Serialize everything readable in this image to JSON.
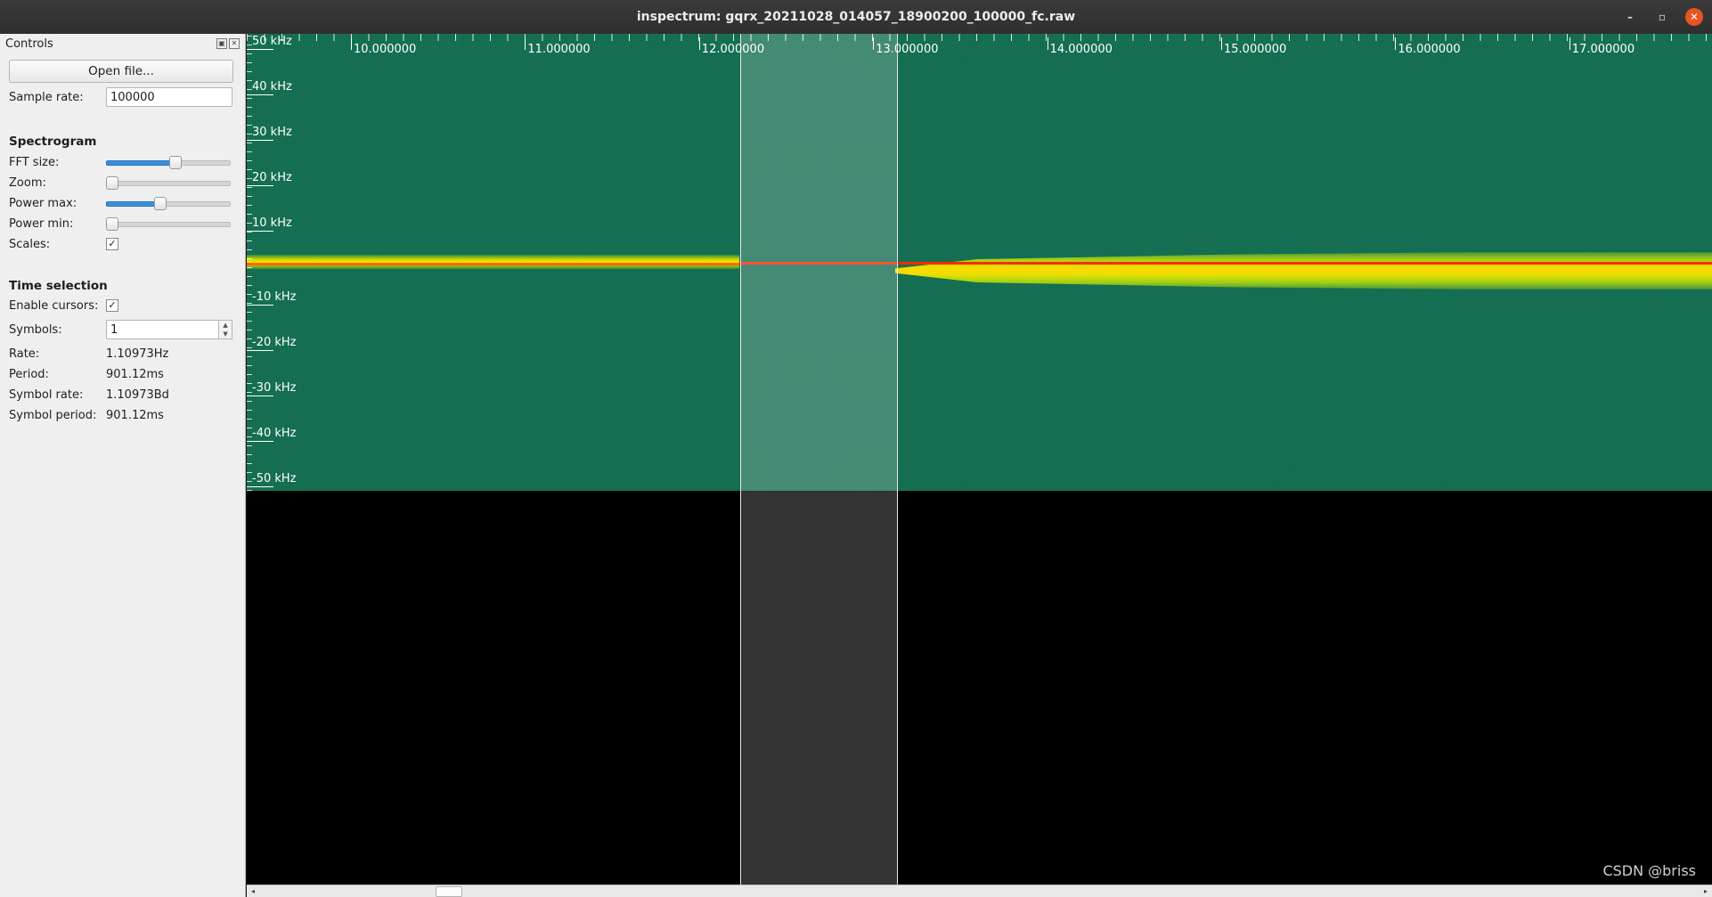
{
  "window": {
    "title": "inspectrum: gqrx_20211028_014057_18900200_100000_fc.raw",
    "minimize": "–",
    "restore": "▫",
    "close": "✕"
  },
  "controls": {
    "dock_title": "Controls",
    "float_icon": "▣",
    "close_icon": "✕",
    "open_file_label": "Open file...",
    "sample_rate_label": "Sample rate:",
    "sample_rate_value": "100000",
    "spectrogram_heading": "Spectrogram",
    "fft_size_label": "FFT size:",
    "fft_size_level": 0.55,
    "zoom_label": "Zoom:",
    "zoom_level": 0.0,
    "power_max_label": "Power max:",
    "power_max_level": 0.43,
    "power_min_label": "Power min:",
    "power_min_level": 0.0,
    "scales_label": "Scales:",
    "scales_checked": "✓",
    "time_selection_heading": "Time selection",
    "enable_cursors_label": "Enable cursors:",
    "enable_cursors_checked": "✓",
    "symbols_label": "Symbols:",
    "symbols_value": "1",
    "rate_label": "Rate:",
    "rate_value": "1.10973Hz",
    "period_label": "Period:",
    "period_value": "901.12ms",
    "symbol_rate_label": "Symbol rate:",
    "symbol_rate_value": "1.10973Bd",
    "symbol_period_label": "Symbol period:",
    "symbol_period_value": "901.12ms"
  },
  "spectrogram": {
    "time_labels": [
      "10.000000",
      "11.000000",
      "12.000000",
      "13.000000",
      "14.000000",
      "15.000000",
      "16.000000",
      "17.000000"
    ],
    "freq_labels": [
      "50 kHz",
      "40 kHz",
      "30 kHz",
      "20 kHz",
      "10 kHz",
      "-10 kHz",
      "-20 kHz",
      "-30 kHz",
      "-40 kHz",
      "-50 kHz"
    ],
    "colors": {
      "noise": "#156f52",
      "signal": "#f3e600",
      "carrier": "#ff2a00"
    }
  },
  "watermark": "CSDN @briss",
  "scrollbar": {
    "left_arrow": "◂",
    "right_arrow": "▸"
  }
}
